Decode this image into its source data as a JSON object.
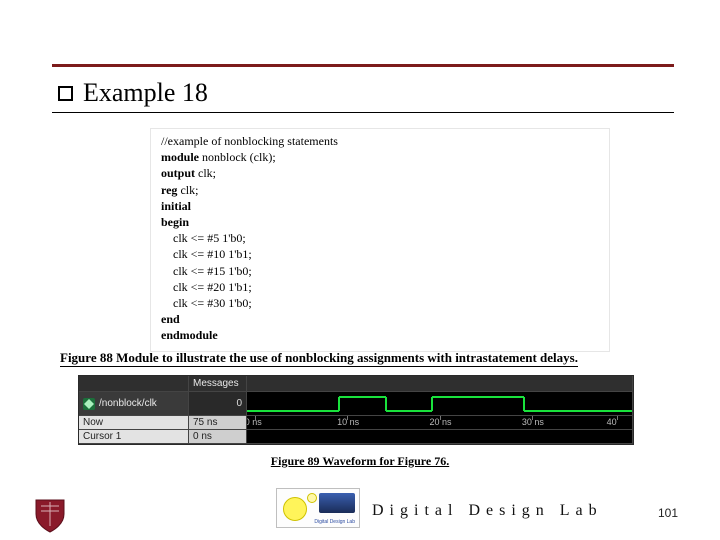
{
  "heading": "Example 18",
  "code": {
    "lines": [
      {
        "text": "//example of nonblocking statements",
        "bold_prefix": 0
      },
      {
        "prefix": "module ",
        "rest": "nonblock (clk);"
      },
      {
        "prefix": "output ",
        "rest": "clk;"
      },
      {
        "prefix": "reg ",
        "rest": "clk;"
      },
      {
        "prefix": "initial",
        "rest": ""
      },
      {
        "prefix": "begin",
        "rest": ""
      },
      {
        "indent": "    ",
        "rest": "clk <= #5 1'b0;"
      },
      {
        "indent": "    ",
        "rest": "clk <= #10 1'b1;"
      },
      {
        "indent": "    ",
        "rest": "clk <= #15 1'b0;"
      },
      {
        "indent": "    ",
        "rest": "clk <= #20 1'b1;"
      },
      {
        "indent": "    ",
        "rest": "clk <= #30 1'b0;"
      },
      {
        "prefix": "end",
        "rest": ""
      },
      {
        "prefix": "endmodule",
        "rest": ""
      }
    ]
  },
  "caption88": "Figure 88 Module to illustrate the use of nonblocking assignments with intrastatement delays.",
  "caption89": "Figure 89 Waveform for Figure 76.",
  "waveform": {
    "messages_label": "Messages",
    "signal_name": "/nonblock/clk",
    "signal_value": "0",
    "now_label": "Now",
    "now_value": "75 ns",
    "cursor_label": "Cursor 1",
    "cursor_value": "0 ns",
    "ticks": [
      "0 ns",
      "10 ns",
      "20 ns",
      "30 ns",
      "40"
    ],
    "tick_positions_pct": [
      2,
      26,
      50,
      74,
      96
    ],
    "transitions": {
      "comment": "clk low→high→low→high→low at 5,10,15,20,30 ns over a 0..~42ns window",
      "window_ns": 42,
      "edges_ns": [
        5,
        10,
        15,
        20,
        30
      ],
      "levels_after_edges": [
        0,
        1,
        0,
        1,
        0
      ]
    }
  },
  "footer": {
    "lab_title": "Digital Design Lab",
    "page_number": "101",
    "lab_logo_caption": "Digital Design Lab"
  }
}
